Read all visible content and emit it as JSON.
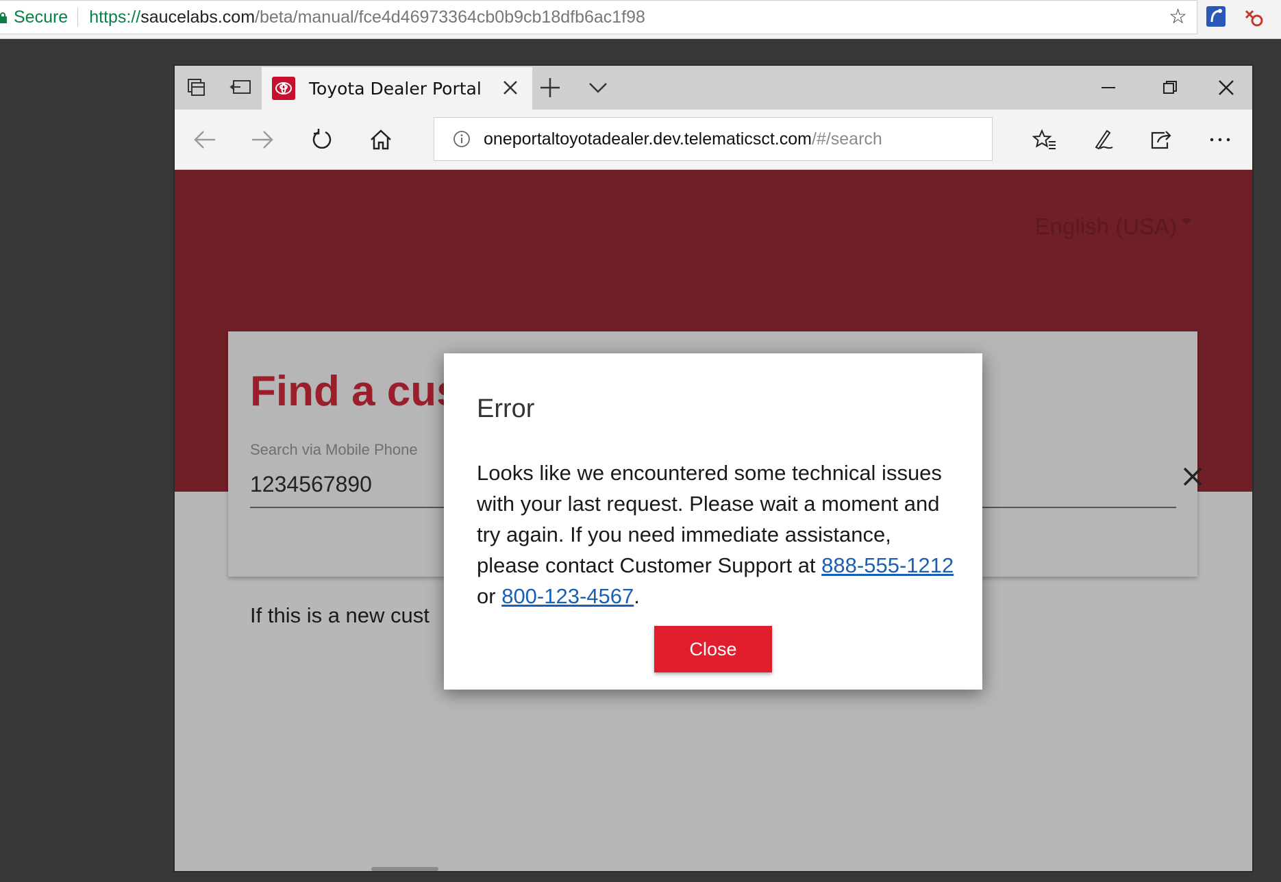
{
  "outer_browser": {
    "secure_label": "Secure",
    "url_scheme": "https://",
    "url_host": "saucelabs.com",
    "url_path": "/beta/manual/fce4d46973364cb0b9cb18dfb6ac1f98",
    "icons": [
      "lock-icon",
      "bookmark-star-icon",
      "extension-icon",
      "extension-icon"
    ]
  },
  "edge_browser": {
    "tab_title": "Toyota Dealer Portal",
    "address_host": "oneportaltoyotadealer.dev.telematicsct.com",
    "address_path": "/#/search",
    "icons": [
      "tab-aside-icon",
      "tab-restore-icon",
      "toyota-favicon",
      "close-tab-icon",
      "new-tab-icon",
      "tab-list-icon",
      "minimize-icon",
      "restore-icon",
      "close-window-icon",
      "back-icon",
      "forward-icon",
      "refresh-icon",
      "home-icon",
      "info-icon",
      "favorites-icon",
      "pen-icon",
      "share-icon",
      "more-icon"
    ]
  },
  "page": {
    "language": "English (USA)",
    "card_title": "Find a cus",
    "search_label": "Search via Mobile Phone",
    "search_value": "1234567890",
    "new_customer_text": "If this is a new cust"
  },
  "dialog": {
    "title": "Error",
    "message": "Looks like we encountered some technical issues with your last request. Please wait a moment and try again. If you need immediate assistance, please contact Customer Support at",
    "phone_1": "888-555-1212",
    "connector": "or",
    "phone_2": "800-123-4567",
    "period": ".",
    "close_label": "Close"
  },
  "colors": {
    "secure_green": "#0b8043",
    "hero_red": "#6f1f25",
    "title_red": "#9a1f2b",
    "button_red": "#e01e2e",
    "link_blue": "#1a5fb4"
  }
}
